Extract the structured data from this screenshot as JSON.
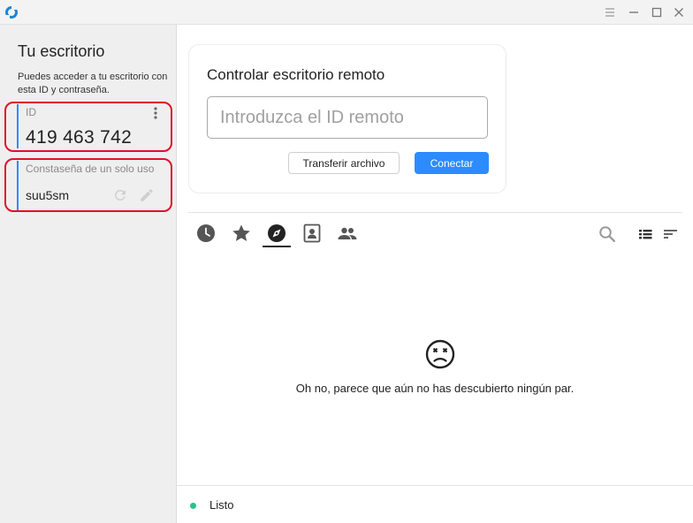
{
  "window": {
    "menu_icon": "menu-icon",
    "minimize_icon": "minimize-icon",
    "maximize_icon": "maximize-icon",
    "close_icon": "close-icon"
  },
  "sidebar": {
    "title": "Tu escritorio",
    "description": "Puedes acceder a tu escritorio con esta ID y contraseña.",
    "id_label": "ID",
    "id_value": "419 463 742",
    "password_label": "Constaseña de un solo uso",
    "password_value": "suu5sm"
  },
  "connect": {
    "title": "Controlar escritorio remoto",
    "placeholder": "Introduzca el ID remoto",
    "transfer_label": "Transferir archivo",
    "connect_label": "Conectar"
  },
  "tabs": [
    {
      "icon": "recent-icon"
    },
    {
      "icon": "favorites-icon"
    },
    {
      "icon": "discovered-icon",
      "active": true
    },
    {
      "icon": "address-book-icon"
    },
    {
      "icon": "group-icon"
    }
  ],
  "empty_state": {
    "icon": "sad-face-icon",
    "message": "Oh no, parece que aún no has descubierto ningún par."
  },
  "status": {
    "text": "Listo",
    "color": "#2bbf8f"
  },
  "colors": {
    "accent": "#2c8cff",
    "highlight": "#e0102a"
  }
}
